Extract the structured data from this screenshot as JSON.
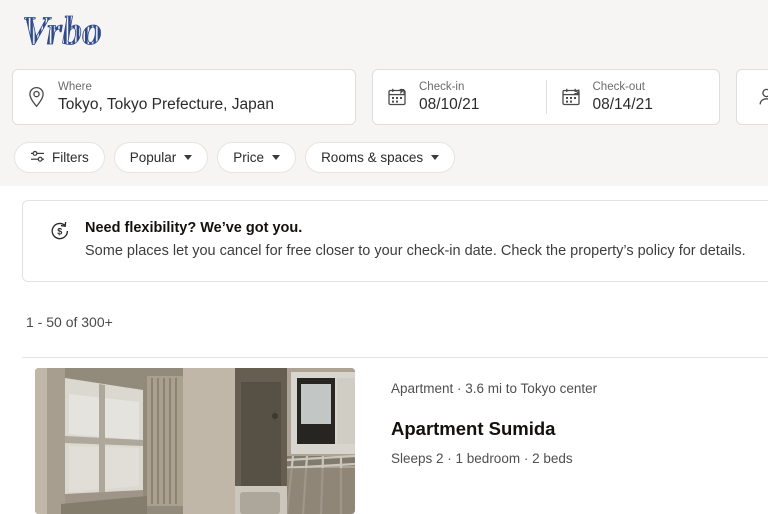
{
  "brand": {
    "logo_text": "Vrbo",
    "logo_color": "#2e4a8c"
  },
  "search": {
    "where": {
      "label": "Where",
      "value": "Tokyo, Tokyo Prefecture, Japan",
      "icon": "location-pin-icon"
    },
    "checkin": {
      "label": "Check-in",
      "value": "08/10/21",
      "icon": "calendar-arrow-in-icon"
    },
    "checkout": {
      "label": "Check-out",
      "value": "08/14/21",
      "icon": "calendar-arrow-out-icon"
    },
    "guests": {
      "label": "",
      "value": "",
      "icon": "guests-person-icon"
    }
  },
  "filters": {
    "chips": [
      {
        "label": "Filters",
        "icon": "sliders-icon",
        "has_caret": false
      },
      {
        "label": "Popular",
        "icon": "",
        "has_caret": true
      },
      {
        "label": "Price",
        "icon": "",
        "has_caret": true
      },
      {
        "label": "Rooms & spaces",
        "icon": "",
        "has_caret": true
      }
    ]
  },
  "banner": {
    "icon": "money-back-refund-icon",
    "title": "Need flexibility? We’ve got you.",
    "body": "Some places let you cancel for free closer to your check-in date. Check the property’s policy for details."
  },
  "results": {
    "count_text": "1 - 50 of 300+"
  },
  "listings": [
    {
      "meta": "Apartment · 3.6 mi to Tokyo center",
      "title": "Apartment Sumida",
      "details": "Sleeps 2 · 1 bedroom · 2 beds",
      "photo_alt": "apartment-interior-photo"
    }
  ]
}
